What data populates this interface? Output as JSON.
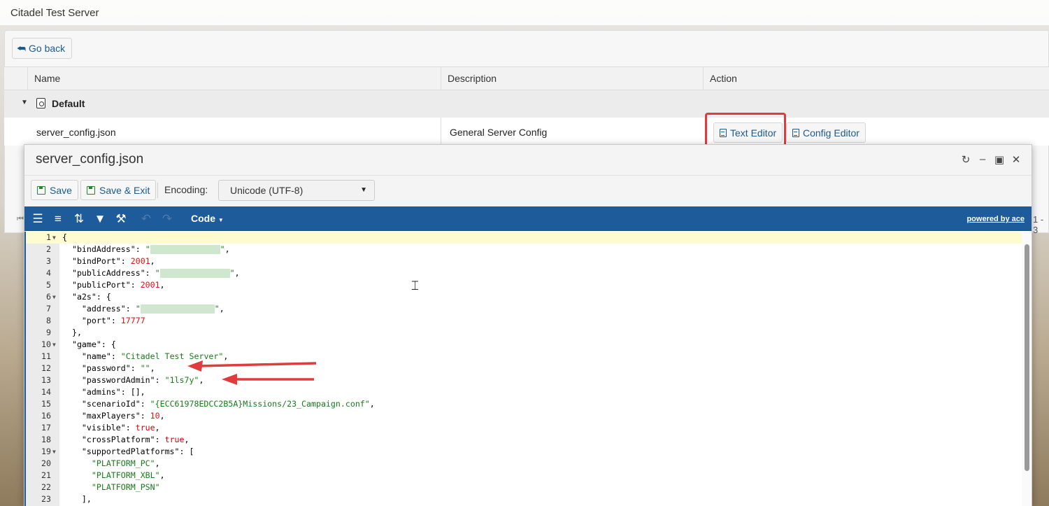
{
  "app_title": "Citadel Test Server",
  "go_back_label": "Go back",
  "grid": {
    "columns": [
      "Name",
      "Description",
      "Action"
    ],
    "group_label": "Default",
    "row": {
      "name": "server_config.json",
      "description": "General Server Config",
      "text_editor_label": "Text Editor",
      "config_editor_label": "Config Editor"
    },
    "pager_text": "1 - 3"
  },
  "modal": {
    "title": "server_config.json",
    "save_label": "Save",
    "save_exit_label": "Save & Exit",
    "encoding_label": "Encoding:",
    "encoding_value": "Unicode (UTF-8)",
    "code_mode_label": "Code",
    "powered_by": "powered by ace"
  },
  "icons": {
    "go_back": "reply-arrow-icon",
    "group": "settings-file-icon",
    "text_editor": "document-icon",
    "config_editor": "config-document-icon",
    "save": "floppy-disk-icon",
    "refresh": "refresh-icon",
    "minimize": "minimize-icon",
    "maximize": "maximize-icon",
    "close": "close-icon"
  },
  "colors": {
    "editor_bar": "#1e5b9b",
    "highlight_box": "#e03c3c",
    "string": "#1a7a1a",
    "number": "#dd1111"
  },
  "code_lines": [
    {
      "n": "1",
      "fold": true,
      "text": "{"
    },
    {
      "n": "2",
      "fold": false,
      "text": "  \"bindAddress\": \"\","
    },
    {
      "n": "3",
      "fold": false,
      "text": "  \"bindPort\": 2001,"
    },
    {
      "n": "4",
      "fold": false,
      "text": "  \"publicAddress\": \"\","
    },
    {
      "n": "5",
      "fold": false,
      "text": "  \"publicPort\": 2001,"
    },
    {
      "n": "6",
      "fold": true,
      "text": "  \"a2s\": {"
    },
    {
      "n": "7",
      "fold": false,
      "text": "    \"address\": \"\","
    },
    {
      "n": "8",
      "fold": false,
      "text": "    \"port\": 17777"
    },
    {
      "n": "9",
      "fold": false,
      "text": "  },"
    },
    {
      "n": "10",
      "fold": true,
      "text": "  \"game\": {"
    },
    {
      "n": "11",
      "fold": false,
      "text": "    \"name\": \"Citadel Test Server\","
    },
    {
      "n": "12",
      "fold": false,
      "text": "    \"password\": \"\","
    },
    {
      "n": "13",
      "fold": false,
      "text": "    \"passwordAdmin\": \"1ls7y\","
    },
    {
      "n": "14",
      "fold": false,
      "text": "    \"admins\": [],"
    },
    {
      "n": "15",
      "fold": false,
      "text": "    \"scenarioId\": \"{ECC61978EDCC2B5A}Missions/23_Campaign.conf\","
    },
    {
      "n": "16",
      "fold": false,
      "text": "    \"maxPlayers\": 10,"
    },
    {
      "n": "17",
      "fold": false,
      "text": "    \"visible\": true,"
    },
    {
      "n": "18",
      "fold": false,
      "text": "    \"crossPlatform\": true,"
    },
    {
      "n": "19",
      "fold": true,
      "text": "    \"supportedPlatforms\": ["
    },
    {
      "n": "20",
      "fold": false,
      "text": "      \"PLATFORM_PC\","
    },
    {
      "n": "21",
      "fold": false,
      "text": "      \"PLATFORM_XBL\","
    },
    {
      "n": "22",
      "fold": false,
      "text": "      \"PLATFORM_PSN\""
    },
    {
      "n": "23",
      "fold": false,
      "text": "    ],"
    }
  ]
}
